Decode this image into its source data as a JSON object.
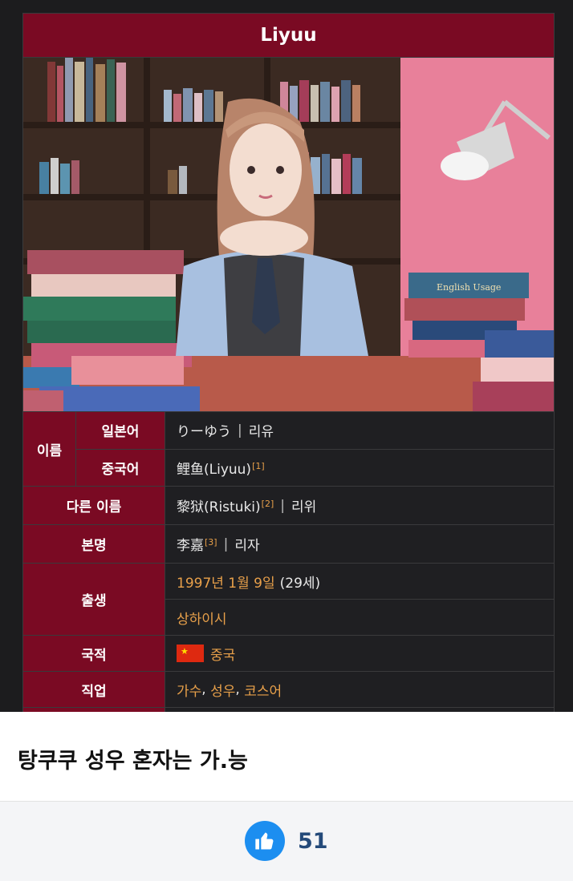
{
  "infobox": {
    "title": "Liyuu",
    "rows": {
      "name_label": "이름",
      "japanese_label": "일본어",
      "japanese_value_a": "りーゆう",
      "japanese_value_b": "리유",
      "chinese_label": "중국어",
      "chinese_value": "鲤鱼(Liyuu)",
      "chinese_ref": "[1]",
      "other_label": "다른 이름",
      "other_value_a": "黎狱(Ristuki)",
      "other_ref": "[2]",
      "other_value_b": "리위",
      "real_label": "본명",
      "real_value_a": "李嘉",
      "real_ref": "[3]",
      "real_value_b": "리자",
      "birth_label": "출생",
      "birth_date": "1997년 1월 9일",
      "birth_age": "(29세)",
      "birth_place": "상하이시",
      "nationality_label": "국적",
      "nationality_value": "중국",
      "job_label": "직업",
      "job_1": "가수",
      "job_2": "성우",
      "job_3": "코스어"
    }
  },
  "post": {
    "title": "탕쿠쿠 성우 혼자는 가.능",
    "like_count": "51"
  },
  "colors": {
    "header_red": "#7a0a23",
    "link_orange": "#e8a04a",
    "like_blue": "#1c8ef0"
  },
  "icons": {
    "like": "thumbs-up-icon",
    "flag": "china-flag-icon"
  }
}
